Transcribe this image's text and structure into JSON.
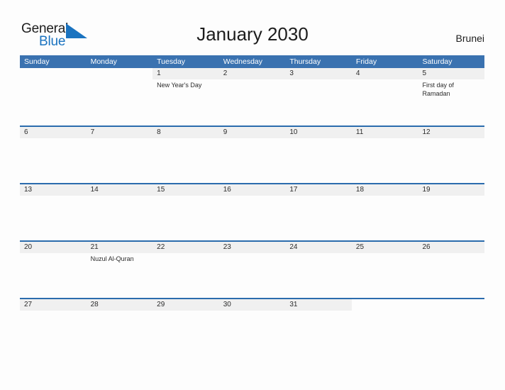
{
  "brand": {
    "name_part1": "General",
    "name_part2": "Blue",
    "logo_icon": "blue-flag-triangle-icon",
    "accent_color": "#1a73c0"
  },
  "header": {
    "title": "January 2030",
    "country": "Brunei"
  },
  "calendar": {
    "header_color": "#3a72b0",
    "row_border_color": "#2b6cad",
    "date_band_color": "#f0f0f0",
    "day_names": [
      "Sunday",
      "Monday",
      "Tuesday",
      "Wednesday",
      "Thursday",
      "Friday",
      "Saturday"
    ],
    "weeks": [
      [
        {
          "date": "",
          "events": []
        },
        {
          "date": "",
          "events": []
        },
        {
          "date": "1",
          "events": [
            "New Year's Day"
          ]
        },
        {
          "date": "2",
          "events": []
        },
        {
          "date": "3",
          "events": []
        },
        {
          "date": "4",
          "events": []
        },
        {
          "date": "5",
          "events": [
            "First day of Ramadan"
          ]
        }
      ],
      [
        {
          "date": "6",
          "events": []
        },
        {
          "date": "7",
          "events": []
        },
        {
          "date": "8",
          "events": []
        },
        {
          "date": "9",
          "events": []
        },
        {
          "date": "10",
          "events": []
        },
        {
          "date": "11",
          "events": []
        },
        {
          "date": "12",
          "events": []
        }
      ],
      [
        {
          "date": "13",
          "events": []
        },
        {
          "date": "14",
          "events": []
        },
        {
          "date": "15",
          "events": []
        },
        {
          "date": "16",
          "events": []
        },
        {
          "date": "17",
          "events": []
        },
        {
          "date": "18",
          "events": []
        },
        {
          "date": "19",
          "events": []
        }
      ],
      [
        {
          "date": "20",
          "events": []
        },
        {
          "date": "21",
          "events": [
            "Nuzul Al-Quran"
          ]
        },
        {
          "date": "22",
          "events": []
        },
        {
          "date": "23",
          "events": []
        },
        {
          "date": "24",
          "events": []
        },
        {
          "date": "25",
          "events": []
        },
        {
          "date": "26",
          "events": []
        }
      ],
      [
        {
          "date": "27",
          "events": []
        },
        {
          "date": "28",
          "events": []
        },
        {
          "date": "29",
          "events": []
        },
        {
          "date": "30",
          "events": []
        },
        {
          "date": "31",
          "events": []
        },
        {
          "date": "",
          "events": []
        },
        {
          "date": "",
          "events": []
        }
      ]
    ]
  }
}
